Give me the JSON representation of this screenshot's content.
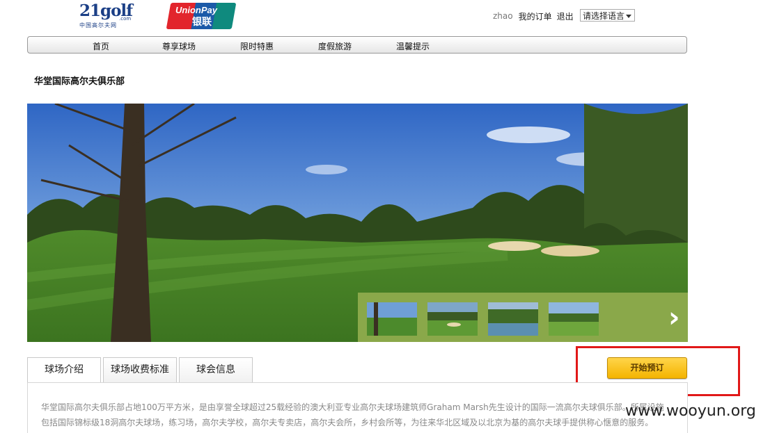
{
  "header": {
    "logo_main": "21golf",
    "logo_com": ".com",
    "logo_sub": "中国高尔夫网",
    "unionpay_en": "UnionPay",
    "unionpay_cn": "银联",
    "username": "zhao",
    "my_orders": "我的订单",
    "logout": "退出",
    "language_select": "请选择语言"
  },
  "nav": [
    {
      "label": "首页"
    },
    {
      "label": "尊享球场"
    },
    {
      "label": "限时特惠"
    },
    {
      "label": "度假旅游"
    },
    {
      "label": "温馨提示"
    }
  ],
  "club": {
    "title": "华堂国际高尔夫俱乐部"
  },
  "gallery": {
    "thumbnail_count": 4,
    "next_icon": "chevron-right-icon"
  },
  "tabs": [
    {
      "label": "球场介绍",
      "active": true
    },
    {
      "label": "球场收费标准",
      "active": false
    },
    {
      "label": "球会信息",
      "active": false
    }
  ],
  "booking": {
    "button_label": "开始预订",
    "button_color": "#f4b400",
    "highlight_color": "#e11818"
  },
  "description": "华堂国际高尔夫俱乐部占地100万平方米，是由享誉全球超过25载经验的澳大利亚专业高尔夫球场建筑师Graham Marsh先生设计的国际一流高尔夫球俱乐部。所属设施包括国际锦标级18洞高尔夫球场，练习场，高尔夫学校，高尔夫专卖店，高尔夫会所，乡村会所等，为往来华北区域及以北京为基的高尔夫球手提供称心惬意的服务。",
  "watermark": "www.wooyun.org"
}
